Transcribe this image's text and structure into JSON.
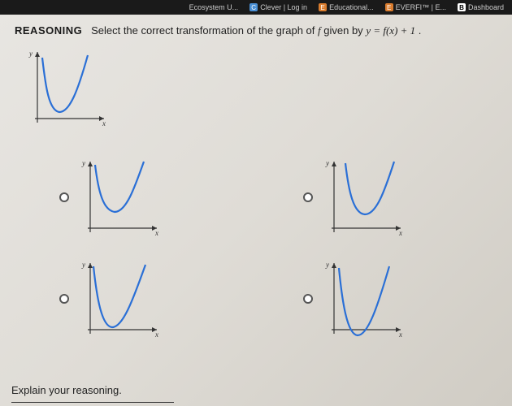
{
  "tabs": [
    {
      "icon": "",
      "label": "Ecosystem U...",
      "iconClass": ""
    },
    {
      "icon": "C",
      "label": "Clever | Log in",
      "iconClass": "c"
    },
    {
      "icon": "E",
      "label": "Educational...",
      "iconClass": "e"
    },
    {
      "icon": "E",
      "label": "EVERFI™ | E...",
      "iconClass": "e"
    },
    {
      "icon": "B",
      "label": "Dashboard",
      "iconClass": "b"
    }
  ],
  "prompt": {
    "label": "REASONING",
    "text_before": "Select the correct transformation of the graph of ",
    "f": "f",
    "text_mid": " given by ",
    "equation": "y = f(x) + 1",
    "period": " ."
  },
  "explain": "Explain your reasoning.",
  "axis_labels": {
    "x": "x",
    "y": "y"
  },
  "chart_data": [
    {
      "id": "stem",
      "type": "line",
      "role": "question-stem",
      "description": "Original f: U-shaped curve, minimum near origin slightly above x-axis",
      "x_range": [
        0,
        10
      ],
      "y_range": [
        0,
        10
      ],
      "curve_points": [
        [
          1.8,
          8.5
        ],
        [
          2.2,
          5.5
        ],
        [
          3.0,
          2.0
        ],
        [
          4.2,
          1.2
        ],
        [
          5.5,
          2.5
        ],
        [
          7.0,
          6.0
        ],
        [
          8.0,
          9.0
        ]
      ]
    },
    {
      "id": "A",
      "type": "line",
      "role": "choice",
      "description": "U-curve shifted up, minimum well above x-axis",
      "curve_points": [
        [
          2.0,
          8.8
        ],
        [
          2.5,
          6.0
        ],
        [
          3.5,
          3.2
        ],
        [
          4.8,
          2.6
        ],
        [
          6.2,
          4.2
        ],
        [
          7.8,
          7.8
        ],
        [
          8.5,
          9.5
        ]
      ]
    },
    {
      "id": "B",
      "type": "line",
      "role": "choice",
      "description": "U-curve shifted right/up",
      "curve_points": [
        [
          2.8,
          9.0
        ],
        [
          3.3,
          6.0
        ],
        [
          4.2,
          3.0
        ],
        [
          5.5,
          2.3
        ],
        [
          7.0,
          4.2
        ],
        [
          8.5,
          8.0
        ],
        [
          9.0,
          9.5
        ]
      ]
    },
    {
      "id": "C",
      "type": "line",
      "role": "choice",
      "description": "U-curve touching near x-axis (like original)",
      "curve_points": [
        [
          1.5,
          8.8
        ],
        [
          2.0,
          5.5
        ],
        [
          3.0,
          1.8
        ],
        [
          4.2,
          1.0
        ],
        [
          5.6,
          2.6
        ],
        [
          7.5,
          6.8
        ],
        [
          8.5,
          9.5
        ]
      ]
    },
    {
      "id": "D",
      "type": "line",
      "role": "choice",
      "description": "Curve dipping below x-axis",
      "curve_points": [
        [
          1.8,
          8.5
        ],
        [
          2.3,
          4.5
        ],
        [
          3.2,
          0.2
        ],
        [
          4.5,
          -0.6
        ],
        [
          5.8,
          1.2
        ],
        [
          7.5,
          5.5
        ],
        [
          8.5,
          9.0
        ]
      ]
    }
  ]
}
